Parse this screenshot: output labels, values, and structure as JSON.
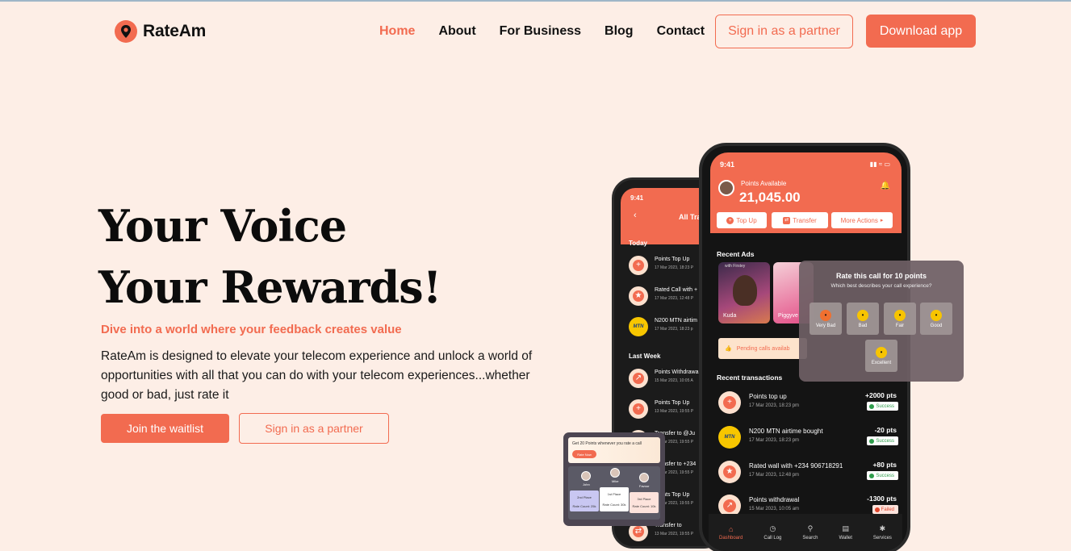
{
  "brand": {
    "name": "RateAm",
    "accent": "#f26b50",
    "background": "#fdeee6"
  },
  "nav": {
    "items": [
      {
        "label": "Home",
        "active": true
      },
      {
        "label": "About"
      },
      {
        "label": "For Business"
      },
      {
        "label": "Blog"
      },
      {
        "label": "Contact"
      }
    ],
    "partner_btn": "Sign in as a partner",
    "download_btn": "Download app"
  },
  "hero": {
    "title_line1": "Your Voice",
    "title_line2": "Your Rewards!",
    "tagline": "Dive into a world where your feedback creates value",
    "description": "RateAm is designed to elevate your telecom experience and unlock a world of opportunities with all that you can do with your telecom experiences...whether good or bad, just rate it",
    "join_btn": "Join the waitlist",
    "partner_btn": "Sign in as a partner"
  },
  "phone_back": {
    "time": "9:41",
    "title": "All Tra",
    "sections": [
      "Today",
      "Last Week"
    ],
    "items": [
      {
        "title": "Points Top Up",
        "date": "17 Mar 2023, 18:23 P",
        "icon": "plus-icon"
      },
      {
        "title": "Rated Call with +",
        "date": "17 Mar 2023, 12:48 P",
        "icon": "star-icon"
      },
      {
        "title": "N200 MTN airtim",
        "date": "17 Mar 2023, 18:23 p",
        "icon": "mtn-logo"
      },
      {
        "title": "Points Withdrawa",
        "date": "15 Mar 2023, 10:05 A",
        "icon": "withdraw-icon"
      },
      {
        "title": "Points Top Up",
        "date": "13 Mar 2023, 19:55 P",
        "icon": "plus-icon"
      },
      {
        "title": "Transfer to @Ju",
        "date": "13 Mar 2023, 19:55 P",
        "icon": "transfer-icon"
      },
      {
        "title": "Transfer to +234",
        "date": "13 Mar 2023, 19:55 P",
        "icon": "transfer-icon"
      },
      {
        "title": "Points Top Up",
        "date": "13 Mar 2023, 19:55 P",
        "icon": "plus-icon"
      },
      {
        "title": "Transfer to",
        "date": "13 Mar 2023, 19:55 P",
        "icon": "transfer-icon"
      }
    ]
  },
  "phone_front": {
    "time": "9:41",
    "status_icons": "signal-wifi-battery",
    "points_label": "Points Available",
    "points_value": "21,045.00",
    "buttons": [
      "Top Up",
      "Transfer",
      "More Actions"
    ],
    "recent_ads_label": "Recent Ads",
    "ads": [
      {
        "label": "Kuda",
        "small": "with Firstey"
      },
      {
        "label": "Piggyve"
      }
    ],
    "pending": "Pending calls availab",
    "recent_tx_label": "Recent transactions",
    "transactions": [
      {
        "title": "Points top up",
        "date": "17 Mar 2023, 18:23 pm",
        "amount": "+2000 pts",
        "status": "Success",
        "icon": "plus-icon"
      },
      {
        "title": "N200 MTN airtime bought",
        "date": "17 Mar 2023, 18:23 pm",
        "amount": "-20 pts",
        "status": "Success",
        "icon": "mtn-logo"
      },
      {
        "title": "Rated wall with +234 906718291",
        "date": "17 Mar 2023, 12:48 pm",
        "amount": "+80 pts",
        "status": "Success",
        "icon": "star-icon"
      },
      {
        "title": "Points withdrawal",
        "date": "15 Mar 2023, 10:05 am",
        "amount": "-1300 pts",
        "status": "Failed",
        "icon": "withdraw-icon"
      }
    ],
    "bottom_nav": [
      "Dashboard",
      "Call Log",
      "Search",
      "Wallet",
      "Services"
    ]
  },
  "rate_popup": {
    "title": "Rate this call for 10 points",
    "subtitle": "Which best describes your call experience?",
    "options": [
      "Very Bad",
      "Bad",
      "Fair",
      "Good",
      "Excellent"
    ]
  },
  "leaderboard": {
    "banner": "Get 20 Points whenever you rate a call",
    "banner_btn": "Rate Now",
    "names": [
      "John",
      "Mike",
      "Favour"
    ],
    "places": [
      "2nd Place",
      "1st Place",
      "3rd Place"
    ],
    "counts": [
      "Rate Count: 25k",
      "Rate Count: 30k",
      "Rate Count: 10k"
    ]
  }
}
